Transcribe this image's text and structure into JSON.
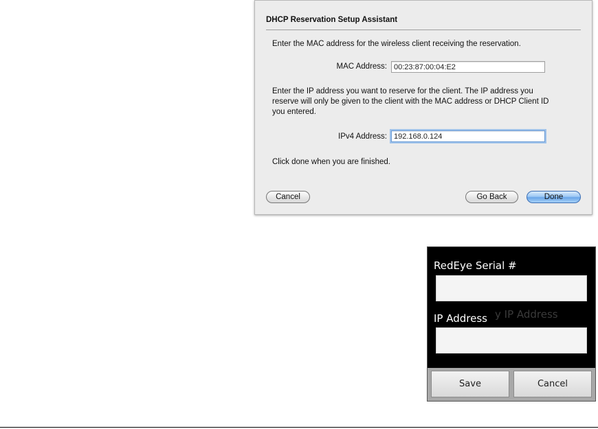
{
  "mac_dialog": {
    "title": "DHCP Reservation Setup Assistant",
    "mac_instruction": "Enter the MAC address for the wireless client receiving the reservation.",
    "mac_label": "MAC Address:",
    "mac_value": "00:23:87:00:04:E2",
    "ip_instruction_1": "Enter the IP address you want to reserve for the client. The IP address you",
    "ip_instruction_2": "reserve will only be given to the client with the MAC address or DHCP Client ID",
    "ip_instruction_3": "you entered.",
    "ip_label": "IPv4 Address:",
    "ip_value": "192.168.0.124",
    "done_instruction": "Click done when you are finished.",
    "cancel_label": "Cancel",
    "go_back_label": "Go Back",
    "done_label": "Done"
  },
  "android_dialog": {
    "serial_label": "RedEye Serial #",
    "ip_label": "IP Address",
    "ghost_text": "y IP Address",
    "save_label": "Save",
    "cancel_label": "Cancel"
  }
}
